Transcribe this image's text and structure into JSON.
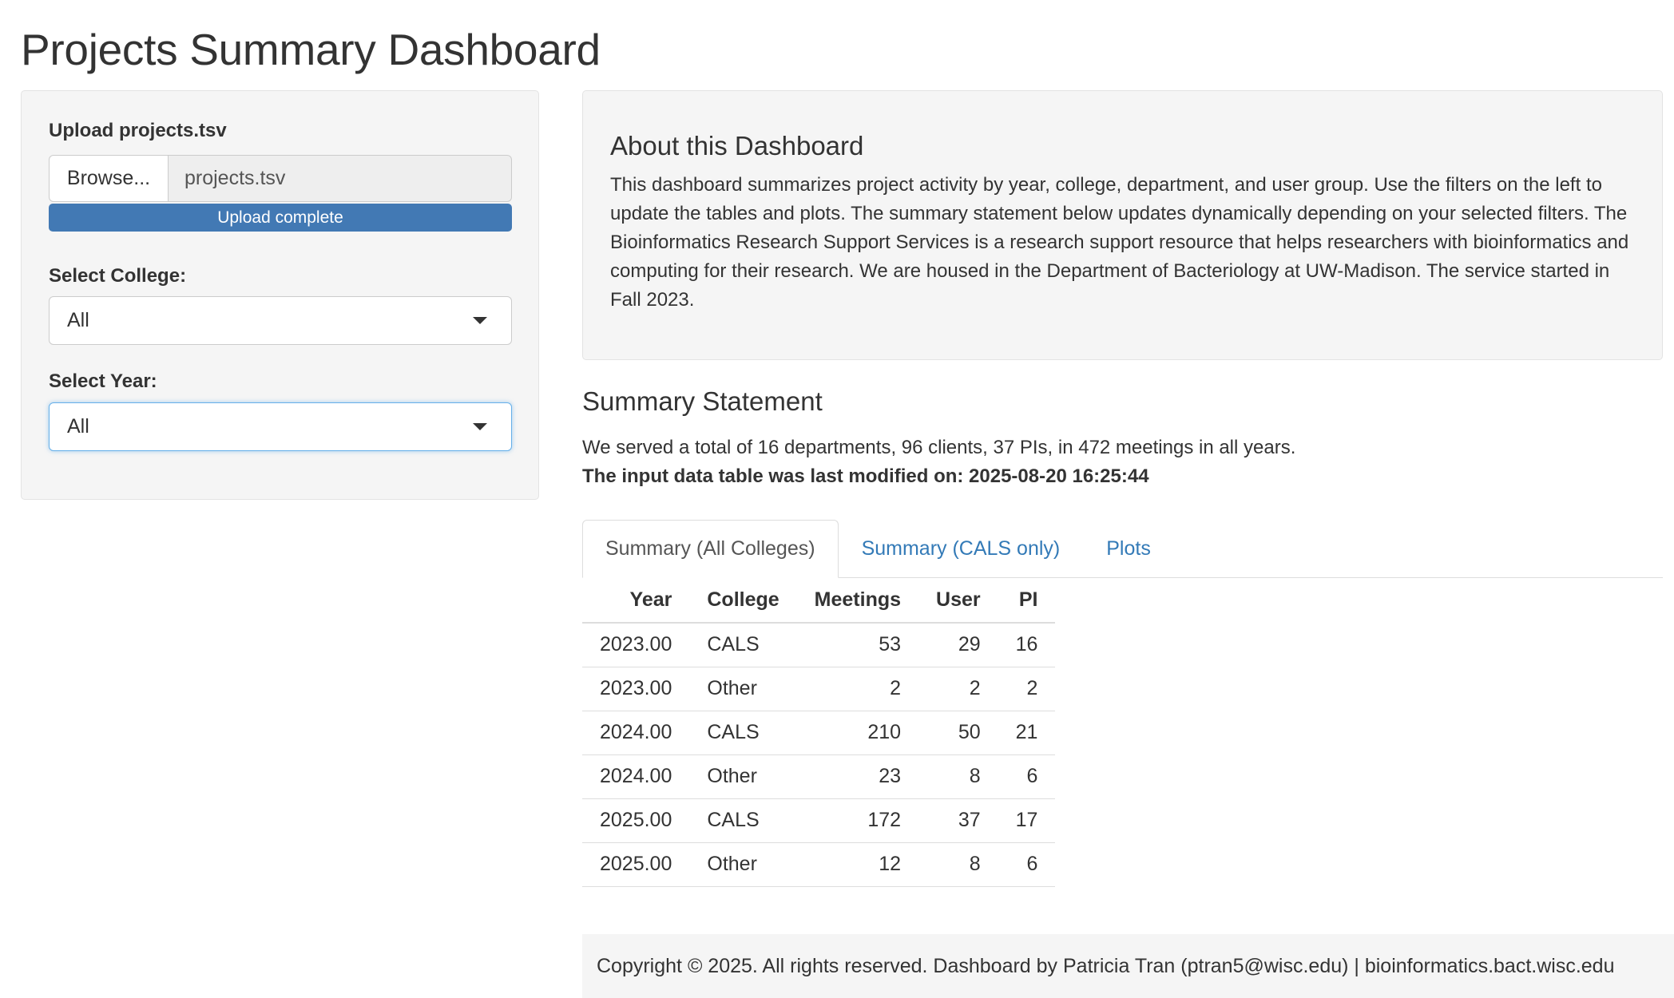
{
  "page": {
    "title": "Projects Summary Dashboard"
  },
  "sidebar": {
    "upload_label": "Upload projects.tsv",
    "browse_label": "Browse...",
    "file_name": "projects.tsv",
    "upload_status": "Upload complete",
    "upload_progress_percent": 100,
    "college_label": "Select College:",
    "college_value": "All",
    "year_label": "Select Year:",
    "year_value": "All"
  },
  "about": {
    "title": "About this Dashboard",
    "text": "This dashboard summarizes project activity by year, college, department, and user group. Use the filters on the left to update the tables and plots. The summary statement below updates dynamically depending on your selected filters. The Bioinformatics Research Support Services is a research support resource that helps researchers with bioinformatics and computing for their research. We are housed in the Department of Bacteriology at UW-Madison. The service started in Fall 2023."
  },
  "summary": {
    "title": "Summary Statement",
    "statement": "We served a total of 16 departments, 96 clients, 37 PIs, in 472 meetings in all years.",
    "modified": "The input data table was last modified on: 2025-08-20 16:25:44"
  },
  "tabs": [
    {
      "label": "Summary (All Colleges)",
      "active": true
    },
    {
      "label": "Summary (CALS only)",
      "active": false
    },
    {
      "label": "Plots",
      "active": false
    }
  ],
  "table": {
    "headers": [
      "Year",
      "College",
      "Meetings",
      "User",
      "PI"
    ],
    "rows": [
      [
        "2023.00",
        "CALS",
        "53",
        "29",
        "16"
      ],
      [
        "2023.00",
        "Other",
        "2",
        "2",
        "2"
      ],
      [
        "2024.00",
        "CALS",
        "210",
        "50",
        "21"
      ],
      [
        "2024.00",
        "Other",
        "23",
        "8",
        "6"
      ],
      [
        "2025.00",
        "CALS",
        "172",
        "37",
        "17"
      ],
      [
        "2025.00",
        "Other",
        "12",
        "8",
        "6"
      ]
    ]
  },
  "footer": {
    "text": "Copyright © 2025. All rights reserved. Dashboard by Patricia Tran (ptran5@wisc.edu) | bioinformatics.bact.wisc.edu"
  },
  "colors": {
    "link": "#337ab7",
    "progress": "#4279b4",
    "well": "#f5f5f5"
  }
}
